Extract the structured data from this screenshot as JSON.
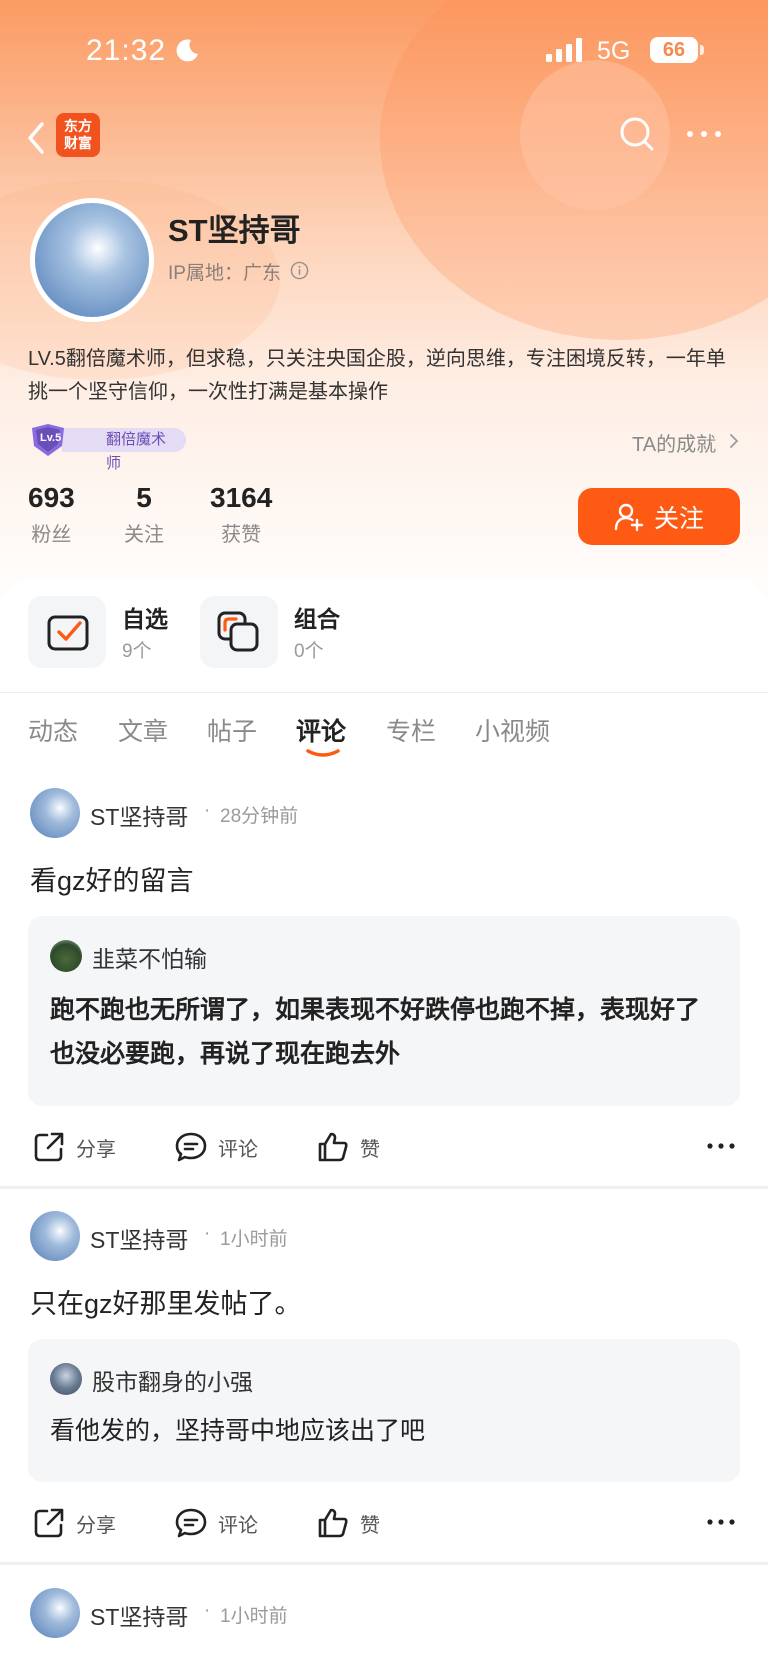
{
  "status_bar": {
    "time": "21:32",
    "network": "5G",
    "battery": "66"
  },
  "nav": {
    "logo_line1": "东方",
    "logo_line2": "财富"
  },
  "profile": {
    "name": "ST坚持哥",
    "ip_location": "IP属地：广东",
    "bio": "LV.5翻倍魔术师，但求稳，只关注央国企股，逆向思维，专注困境反转，一年单挑一个坚守信仰，一次性打满是基本操作",
    "level_short": "Lv.5",
    "level_title": "翻倍魔术师",
    "achievements_link": "TA的成就",
    "stats": [
      {
        "value": "693",
        "label": "粉丝"
      },
      {
        "value": "5",
        "label": "关注"
      },
      {
        "value": "3164",
        "label": "获赞"
      }
    ],
    "follow_label": "关注"
  },
  "watchlists": [
    {
      "title": "自选",
      "count": "9个"
    },
    {
      "title": "组合",
      "count": "0个"
    }
  ],
  "tabs": [
    "动态",
    "文章",
    "帖子",
    "评论",
    "专栏",
    "小视频"
  ],
  "active_tab": "评论",
  "posts": [
    {
      "author": "ST坚持哥",
      "time": "28分钟前",
      "text": "看gz好的留言",
      "quote_author": "韭菜不怕输",
      "quote_text": "跑不跑也无所谓了，如果表现不好跌停也跑不掉，表现好了也没必要跑，再说了现在跑去外"
    },
    {
      "author": "ST坚持哥",
      "time": "1小时前",
      "text": "只在gz好那里发帖了。",
      "quote_author": "股市翻身的小强",
      "quote_text": "看他发的，坚持哥中地应该出了吧"
    },
    {
      "author": "ST坚持哥",
      "time": "1小时前"
    }
  ],
  "actions": {
    "share": "分享",
    "comment": "评论",
    "like": "赞"
  },
  "colors": {
    "accent": "#ff5a14",
    "header_top": "#fb9b63",
    "level_purple": "#6b4fb8"
  }
}
